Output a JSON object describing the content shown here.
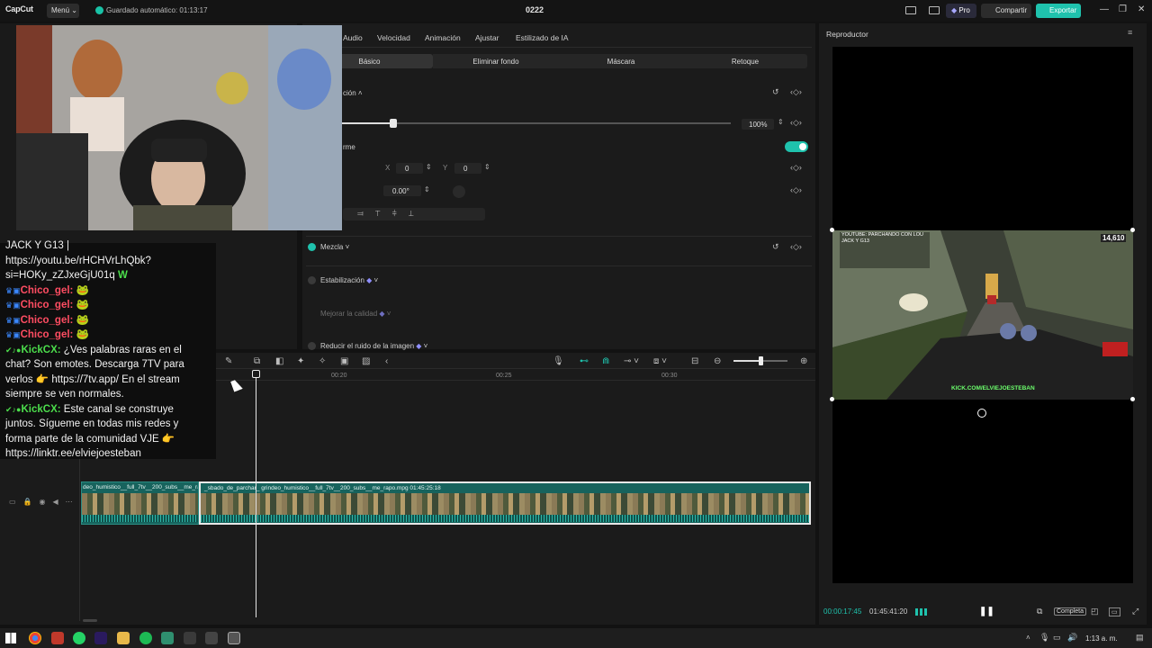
{
  "app": {
    "logo": "CapCut",
    "menu_label": "Menú",
    "autosave": "Guardado automático: 01:13:17",
    "project_name": "0222",
    "pro_label": "Pro",
    "share_label": "Compartir",
    "export_label": "Exportar",
    "accent_color": "#1fc2ad"
  },
  "props": {
    "tabs": [
      "Audio",
      "Velocidad",
      "Animación",
      "Ajustar",
      "Estilizado de IA"
    ],
    "subtabs": [
      "Básico",
      "Eliminar fondo",
      "Máscara",
      "Retoque"
    ],
    "section_posicion": "ción",
    "scale_value": "100%",
    "uniform_label": "rme",
    "x_label": "X",
    "x_value": "0",
    "y_label": "Y",
    "y_value": "0",
    "rotation_value": "0.00°",
    "mezcla": "Mezcla",
    "estabilizacion": "Estabilización",
    "mejorar": "Mejorar la calidad",
    "reducir": "Reducir el ruido de la imagen"
  },
  "chat": {
    "lines": [
      {
        "kind": "text",
        "text": "JACK Y G13 |"
      },
      {
        "kind": "text",
        "text": "https://youtu.be/rHCHVrLhQbk?"
      },
      {
        "kind": "text_w",
        "text": "si=HOKy_zZJxeGjU01q",
        "badge": "W"
      },
      {
        "kind": "user",
        "name": "Chico_gel:",
        "msg": "🐸"
      },
      {
        "kind": "user",
        "name": "Chico_gel:",
        "msg": "🐸"
      },
      {
        "kind": "user",
        "name": "Chico_gel:",
        "msg": "🐸"
      },
      {
        "kind": "user",
        "name": "Chico_gel:",
        "msg": "🐸"
      }
    ],
    "kick1_name": "KickCX:",
    "kick1_msg": "¿Ves palabras raras en el chat? Son emotes. Descarga 7TV para verlos 👉 https://7tv.app/ En el stream siempre se ven normales.",
    "kick2_name": "KickCX:",
    "kick2_msg": "Este canal se construye juntos. Sígueme en todas mis redes y forma parte de la comunidad VJE 👉 https://linktr.ee/elviejoesteban"
  },
  "timeline": {
    "ruler": [
      "00:20",
      "00:25",
      "00:30"
    ],
    "clip1_label": "deo_humistico__full_7tv__200_subs__me_rap",
    "clip2_label": "_sbado_de_parchar_ grindeo_humistico__full_7tv__200_subs__me_rapo.mpg  01:45:25:18"
  },
  "player": {
    "title": "Reproductor",
    "current_time": "00:00:17:45",
    "total_time": "01:45:41:20",
    "quality": "Completa",
    "overlay_text": "YOUTUBE: PARCHANDO CON LOU JACK Y G13",
    "overlay_url": "KICK.COM/ELVIEJOESTEBAN",
    "sub_count": "14,610"
  },
  "taskbar": {
    "time": "1:13 a. m."
  }
}
